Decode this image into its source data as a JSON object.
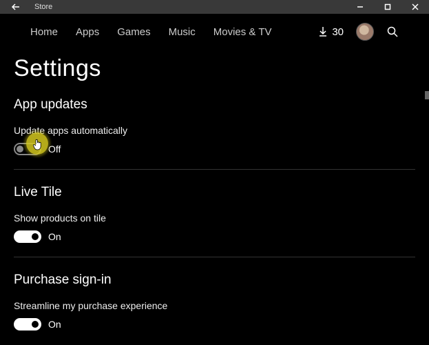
{
  "window": {
    "title": "Store"
  },
  "nav": {
    "items": [
      "Home",
      "Apps",
      "Games",
      "Music",
      "Movies & TV"
    ],
    "download_count": "30"
  },
  "page": {
    "title": "Settings"
  },
  "sections": {
    "app_updates": {
      "title": "App updates",
      "toggle_label": "Update apps automatically",
      "toggle_value": "Off"
    },
    "live_tile": {
      "title": "Live Tile",
      "toggle_label": "Show products on tile",
      "toggle_value": "On"
    },
    "purchase": {
      "title": "Purchase sign-in",
      "toggle_label": "Streamline my purchase experience",
      "toggle_value": "On"
    }
  }
}
